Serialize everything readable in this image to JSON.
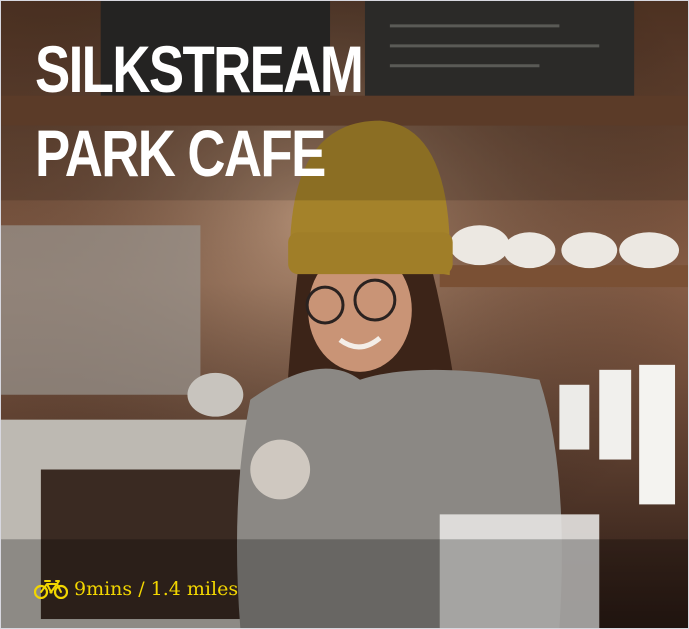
{
  "card": {
    "title_line1": "SILKSTREAM",
    "title_line2": "PARK CAFE",
    "travel_text": "9mins / 1.4 miles",
    "travel_icon": "bicycle-icon",
    "accent_color": "#f2d600"
  }
}
